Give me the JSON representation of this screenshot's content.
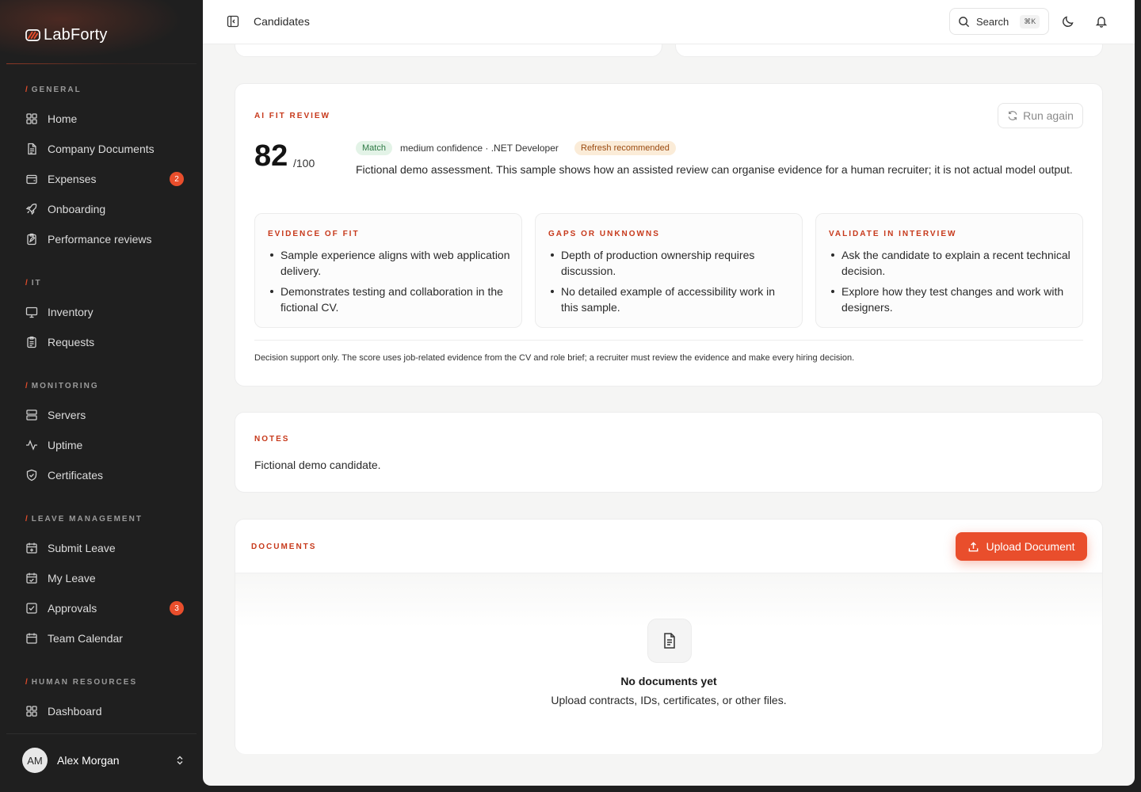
{
  "brand": {
    "name": "LabForty",
    "accent": "#e94e2c"
  },
  "sidebar": {
    "sections": [
      {
        "label": "GENERAL",
        "items": [
          {
            "label": "Home",
            "icon": "grid-icon"
          },
          {
            "label": "Company Documents",
            "icon": "document-icon"
          },
          {
            "label": "Expenses",
            "icon": "wallet-icon",
            "badge": "2"
          },
          {
            "label": "Onboarding",
            "icon": "rocket-icon"
          },
          {
            "label": "Performance reviews",
            "icon": "clipboard-edit-icon"
          }
        ]
      },
      {
        "label": "IT",
        "items": [
          {
            "label": "Inventory",
            "icon": "monitor-icon"
          },
          {
            "label": "Requests",
            "icon": "clipboard-list-icon"
          }
        ]
      },
      {
        "label": "MONITORING",
        "items": [
          {
            "label": "Servers",
            "icon": "server-icon"
          },
          {
            "label": "Uptime",
            "icon": "activity-icon"
          },
          {
            "label": "Certificates",
            "icon": "shield-icon"
          }
        ]
      },
      {
        "label": "LEAVE MANAGEMENT",
        "items": [
          {
            "label": "Submit Leave",
            "icon": "calendar-plus-icon"
          },
          {
            "label": "My Leave",
            "icon": "calendar-check-icon"
          },
          {
            "label": "Approvals",
            "icon": "check-square-icon",
            "badge": "3"
          },
          {
            "label": "Team Calendar",
            "icon": "calendar-icon"
          }
        ]
      },
      {
        "label": "HUMAN RESOURCES",
        "items": [
          {
            "label": "Dashboard",
            "icon": "grid-icon"
          }
        ]
      }
    ],
    "user": {
      "initials": "AM",
      "name": "Alex Morgan"
    }
  },
  "topbar": {
    "breadcrumb": "Candidates",
    "search_label": "Search",
    "search_shortcut": "⌘K"
  },
  "fit_review": {
    "title": "AI FIT REVIEW",
    "run_again_label": "Run again",
    "score": "82",
    "score_max": "/100",
    "match_tag": "Match",
    "meta": "medium confidence · .NET Developer",
    "refresh_tag": "Refresh recommended",
    "summary": "Fictional demo assessment. This sample shows how an assisted review can organise evidence for a human recruiter; it is not actual model output.",
    "columns": [
      {
        "title": "EVIDENCE OF FIT",
        "points": [
          "Sample experience aligns with web application delivery.",
          "Demonstrates testing and collaboration in the fictional CV."
        ]
      },
      {
        "title": "GAPS OR UNKNOWNS",
        "points": [
          "Depth of production ownership requires discussion.",
          "No detailed example of accessibility work in this sample."
        ]
      },
      {
        "title": "VALIDATE IN INTERVIEW",
        "points": [
          "Ask the candidate to explain a recent technical decision.",
          "Explore how they test changes and work with designers."
        ]
      }
    ],
    "disclaimer": "Decision support only. The score uses job-related evidence from the CV and role brief; a recruiter must review the evidence and make every hiring decision."
  },
  "notes": {
    "title": "NOTES",
    "text": "Fictional demo candidate."
  },
  "documents": {
    "title": "DOCUMENTS",
    "upload_label": "Upload Document",
    "empty_title": "No documents yet",
    "empty_subtitle": "Upload contracts, IDs, certificates, or other files."
  }
}
